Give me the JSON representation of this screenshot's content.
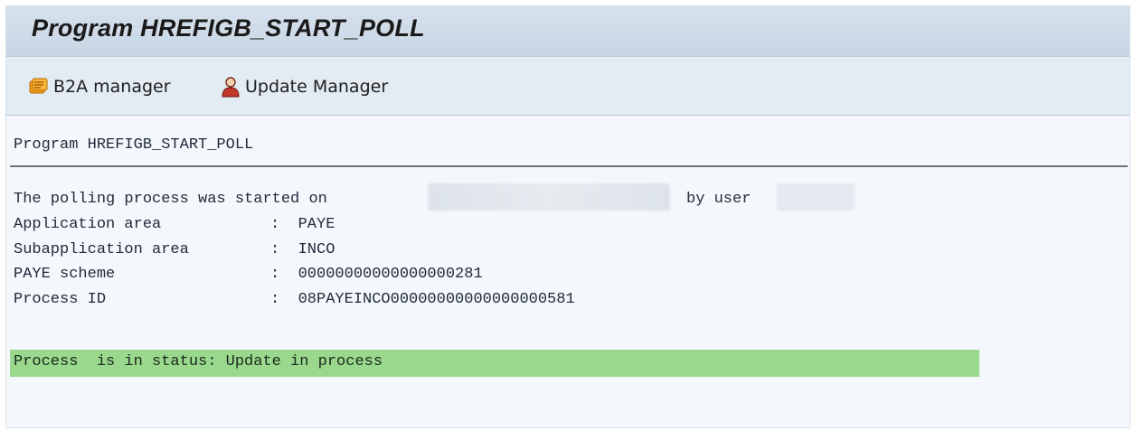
{
  "window": {
    "title": "Program HREFIGB_START_POLL"
  },
  "toolbar": {
    "b2a_label": "B2A manager",
    "b2a_icon": "b2a-manager-icon",
    "update_label": "Update Manager",
    "update_icon": "user-icon"
  },
  "content": {
    "header": "Program HREFIGB_START_POLL",
    "started_prefix": "The polling process was started on",
    "by_user": "by user",
    "fields": [
      {
        "label": "Application area",
        "sep": ":",
        "value": "PAYE"
      },
      {
        "label": "Subapplication area",
        "sep": ":",
        "value": "INCO"
      },
      {
        "label": "PAYE scheme",
        "sep": ":",
        "value": "00000000000000000281"
      },
      {
        "label": "Process ID",
        "sep": ":",
        "value": "08PAYEINCO00000000000000000581"
      }
    ],
    "status": "Process  is in status: Update in process",
    "status_color": "#99d88d"
  }
}
